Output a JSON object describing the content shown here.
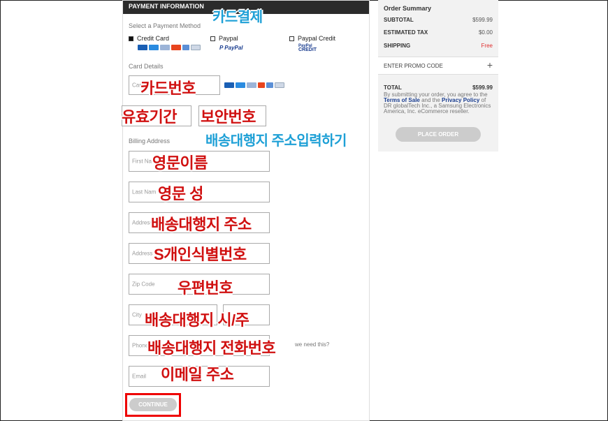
{
  "payment": {
    "header": "PAYMENT INFORMATION",
    "select_method_label": "Select a Payment Method",
    "methods": [
      {
        "label": "Credit Card",
        "selected": true
      },
      {
        "label": "Paypal",
        "selected": false
      },
      {
        "label": "Paypal Credit",
        "selected": false
      }
    ],
    "paypal_logo": "PayPal",
    "paypal_credit_logo_top": "PayPal",
    "paypal_credit_logo_bottom": "CREDIT",
    "card_details_label": "Card Details",
    "card_number_placeholder": "Card",
    "billing_address_label": "Billing Address",
    "first_name_placeholder": "First Na",
    "last_name_placeholder": "Last Nam",
    "address1_placeholder": "Address",
    "address2_placeholder": "Address",
    "zip_placeholder": "Zip Code",
    "city_placeholder": "City",
    "phone_placeholder": "Phone",
    "phone_why": "we need this?",
    "email_placeholder": "Email",
    "continue_label": "CONTINUE",
    "card_colors": [
      "#1a5fb4",
      "#2a8be0",
      "#9cb4d8",
      "#e8451e",
      "#5b8fd6",
      "#cfd8e6"
    ]
  },
  "annotations": {
    "card_payment": "카드결제",
    "card_number": "카드번호",
    "expiry": "유효기간",
    "security_code": "보안번호",
    "shipping_address_input": "배송대행지 주소입력하기",
    "first_name": "영문이름",
    "last_name": "영문 성",
    "address": "배송대행지 주소",
    "personal_id": "S개인식별번호",
    "zip": "우편번호",
    "city_state": "배송대행지 시/주",
    "phone": "배송대행지 전화번호",
    "email": "이메일 주소"
  },
  "summary": {
    "title": "Order Summary",
    "subtotal_label": "SUBTOTAL",
    "subtotal_value": "$599.99",
    "tax_label": "ESTIMATED TAX",
    "tax_value": "$0.00",
    "shipping_label": "SHIPPING",
    "shipping_value": "Free",
    "promo_label": "ENTER PROMO CODE",
    "promo_icon": "+",
    "total_label": "TOTAL",
    "total_value": "$599.99",
    "disclaimer_pre": "By submitting your order, you agree to the ",
    "terms_link": "Terms of Sale",
    "disclaimer_mid": " and the ",
    "privacy_link": "Privacy Policy",
    "disclaimer_post": " of DR globalTech Inc., a Samsung Electronics America, Inc. eCommerce reseller.",
    "place_order_label": "PLACE ORDER"
  }
}
